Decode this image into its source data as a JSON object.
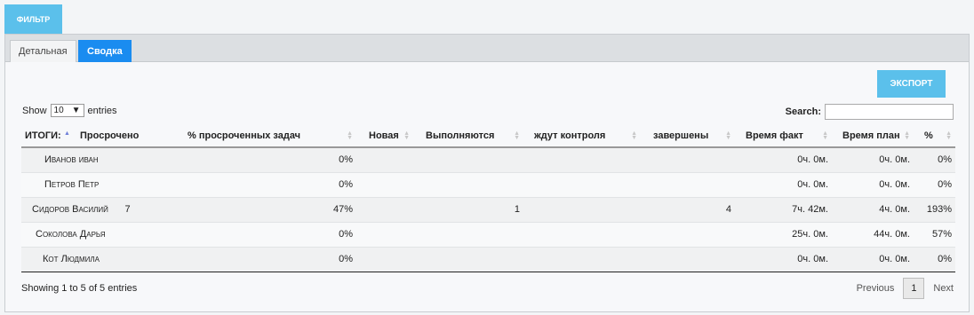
{
  "filter_label": "ФИЛЬТР",
  "tabs": [
    {
      "label": "Детальная",
      "active": false
    },
    {
      "label": "Сводка",
      "active": true
    }
  ],
  "export_label": "ЭКСПОРТ",
  "length": {
    "show": "Show",
    "value": "10",
    "entries": "entries"
  },
  "search": {
    "label": "Search:",
    "value": ""
  },
  "columns": [
    "ИТОГИ:",
    "Просрочено",
    "% просроченных задач",
    "Новая",
    "Выполняются",
    "ждут контроля",
    "завершены",
    "Время факт",
    "Время план",
    "%"
  ],
  "rows": [
    [
      "Иванов иван",
      "",
      "0%",
      "",
      "",
      "",
      "",
      "0ч. 0м.",
      "0ч. 0м.",
      "0%"
    ],
    [
      "Петров Петр",
      "",
      "0%",
      "",
      "",
      "",
      "",
      "0ч. 0м.",
      "0ч. 0м.",
      "0%"
    ],
    [
      "Сидоров Василий",
      "7",
      "47%",
      "",
      "1",
      "",
      "4",
      "7ч. 42м.",
      "4ч. 0м.",
      "193%"
    ],
    [
      "Соколова Дарья",
      "",
      "0%",
      "",
      "",
      "",
      "",
      "25ч. 0м.",
      "44ч. 0м.",
      "57%"
    ],
    [
      "Кот Людмила",
      "",
      "0%",
      "",
      "",
      "",
      "",
      "0ч. 0м.",
      "0ч. 0м.",
      "0%"
    ]
  ],
  "info": "Showing 1 to 5 of 5 entries",
  "pager": {
    "previous": "Previous",
    "page": "1",
    "next": "Next"
  },
  "colors": {
    "accent": "#5bc0eb",
    "active_tab": "#1a8cf0"
  }
}
